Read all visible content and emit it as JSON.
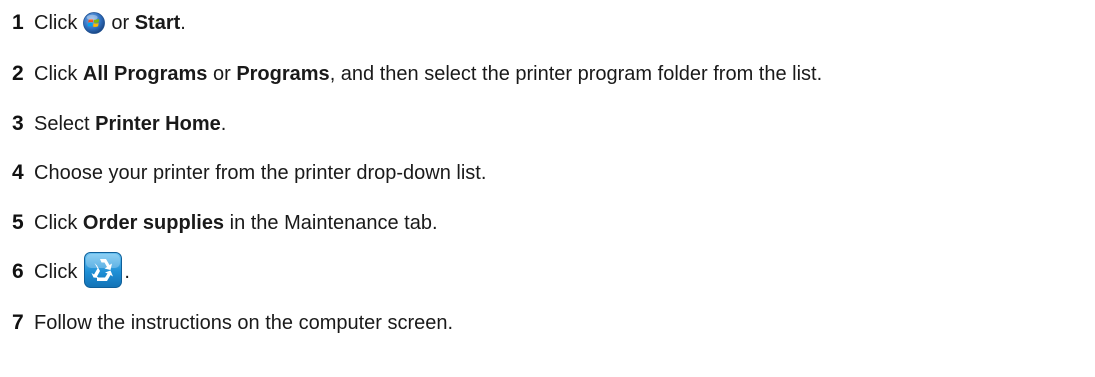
{
  "steps": [
    {
      "number": "1",
      "parts": {
        "a": "Click",
        "icon": "windows-start-orb-icon",
        "b": "or",
        "c": "Start",
        "d": "."
      }
    },
    {
      "number": "2",
      "parts": {
        "a": "Click",
        "b": "All Programs",
        "c": "or",
        "d": "Programs",
        "e": ", and then select the printer program folder from the list."
      }
    },
    {
      "number": "3",
      "parts": {
        "a": "Select",
        "b": "Printer Home",
        "c": "."
      }
    },
    {
      "number": "4",
      "parts": {
        "a": "Choose your printer from the printer drop-down list."
      }
    },
    {
      "number": "5",
      "parts": {
        "a": "Click",
        "b": "Order supplies",
        "c": "in the Maintenance tab."
      }
    },
    {
      "number": "6",
      "parts": {
        "a": "Click",
        "icon": "recycle-supplies-icon",
        "b": "."
      }
    },
    {
      "number": "7",
      "parts": {
        "a": "Follow the instructions on the computer screen."
      }
    }
  ],
  "colors": {
    "text": "#1a1a1a",
    "recycle_icon_blue": "#1e8fd6",
    "orb_blue": "#2f6fbf"
  }
}
